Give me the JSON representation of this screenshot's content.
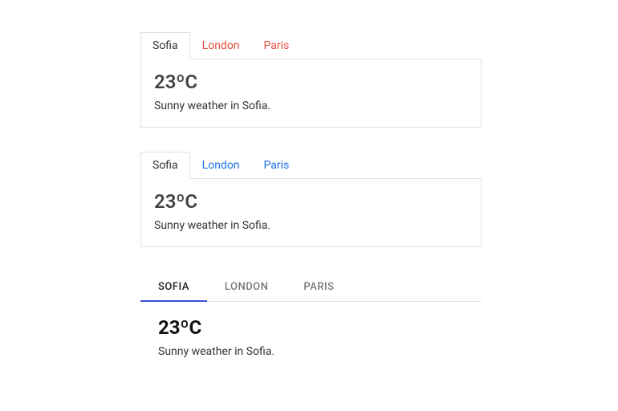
{
  "tabs": [
    {
      "label": "Sofia",
      "active": true
    },
    {
      "label": "London",
      "active": false
    },
    {
      "label": "Paris",
      "active": false
    }
  ],
  "panel": {
    "temperature": "23ºC",
    "description": "Sunny weather in Sofia."
  }
}
